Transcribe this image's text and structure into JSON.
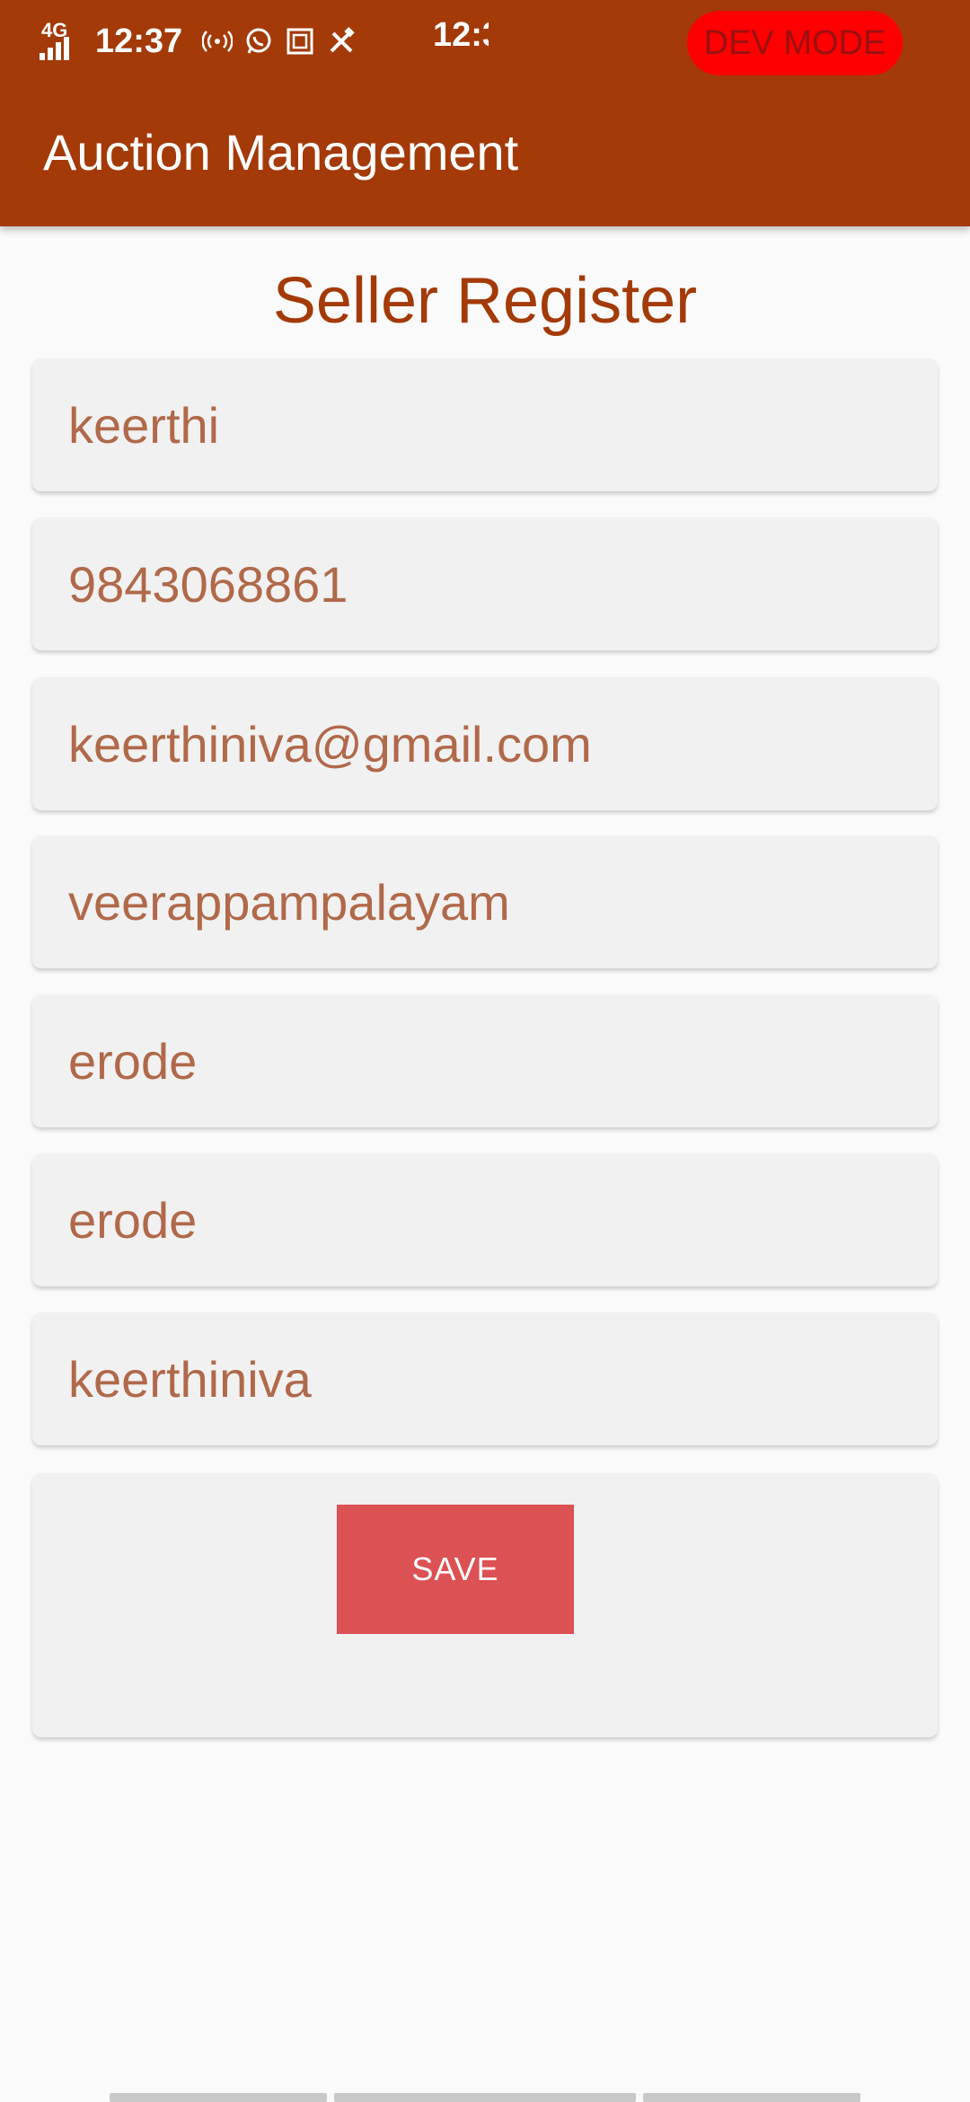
{
  "status_bar": {
    "network_label": "4G",
    "time": "12:37",
    "time_duplicate": "12:3",
    "dev_badge": "DEV MODE",
    "icons": [
      "signal-icon",
      "hotspot-icon",
      "whatsapp-icon",
      "screenshot-icon",
      "tools-icon"
    ]
  },
  "app_bar": {
    "title": "Auction Management"
  },
  "page": {
    "heading": "Seller Register"
  },
  "form": {
    "fields": [
      {
        "name": "name-field",
        "value": "keerthi"
      },
      {
        "name": "phone-field",
        "value": "9843068861"
      },
      {
        "name": "email-field",
        "value": "keerthiniva@gmail.com"
      },
      {
        "name": "address-field",
        "value": "veerappampalayam"
      },
      {
        "name": "city-field",
        "value": "erode"
      },
      {
        "name": "district-field",
        "value": "erode"
      },
      {
        "name": "password-field",
        "value": "keerthiniva"
      }
    ],
    "save_label": "SAVE"
  },
  "colors": {
    "primary": "#a33a08",
    "accent_button": "#dc5154",
    "field_text": "#b0694a",
    "dev_badge": "#ff0000"
  }
}
